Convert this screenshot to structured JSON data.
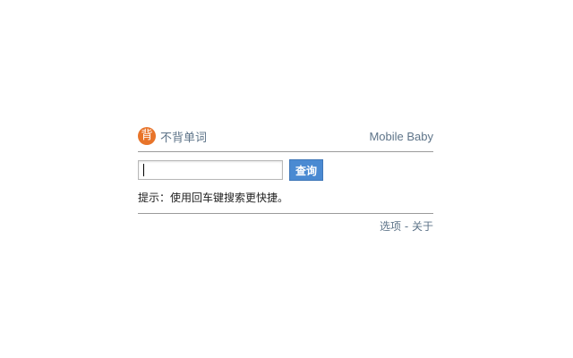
{
  "header": {
    "logo_char": "背",
    "app_name": "不背单词",
    "brand": "Mobile Baby"
  },
  "search": {
    "value": "",
    "placeholder": "",
    "button_label": "查询"
  },
  "hint": "提示：使用回车键搜索更快捷。",
  "footer": {
    "options_label": "选项",
    "separator": "-",
    "about_label": "关于"
  },
  "colors": {
    "logo": "#e8742a",
    "button": "#4a8ad2",
    "link": "#5e7489"
  }
}
